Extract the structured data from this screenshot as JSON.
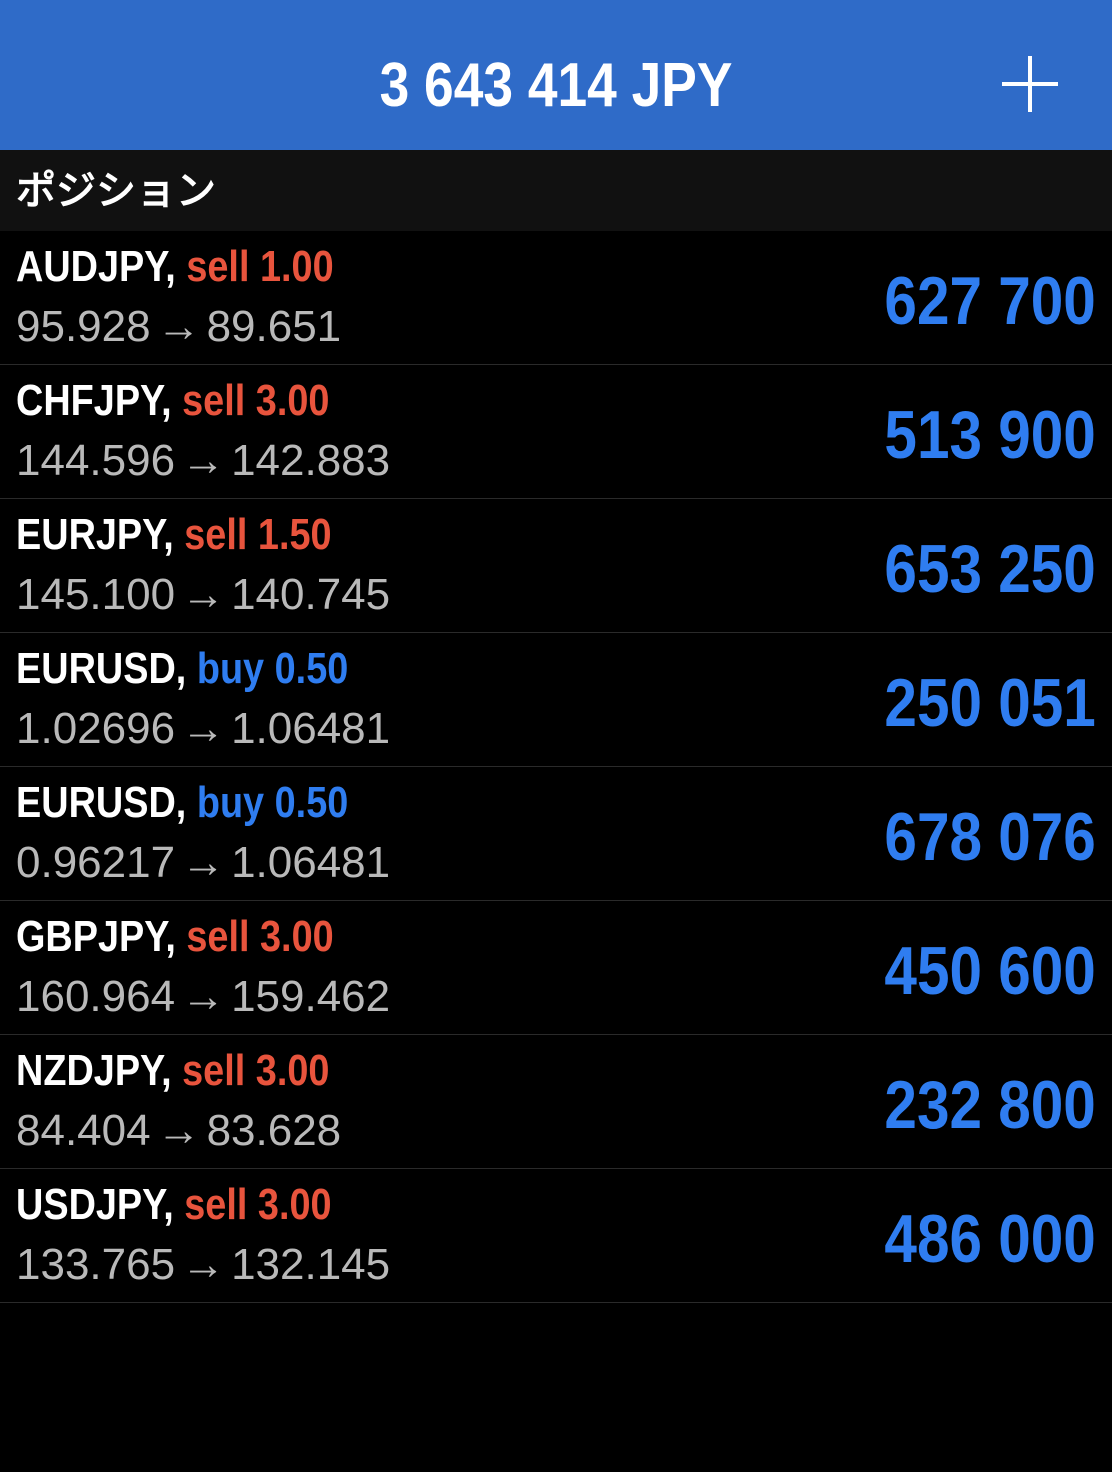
{
  "colors": {
    "header_bg": "#2f6bc8",
    "sell": "#e8543d",
    "buy": "#2f7df0",
    "profit": "#2f7df0"
  },
  "header": {
    "balance": "3 643 414 JPY",
    "add_icon": "plus-icon"
  },
  "section": {
    "title": "ポジション"
  },
  "positions": [
    {
      "symbol": "AUDJPY,",
      "side": "sell",
      "lots": "1.00",
      "open": "95.928",
      "arrow": "→",
      "current": "89.651",
      "profit": "627 700"
    },
    {
      "symbol": "CHFJPY,",
      "side": "sell",
      "lots": "3.00",
      "open": "144.596",
      "arrow": "→",
      "current": "142.883",
      "profit": "513 900"
    },
    {
      "symbol": "EURJPY,",
      "side": "sell",
      "lots": "1.50",
      "open": "145.100",
      "arrow": "→",
      "current": "140.745",
      "profit": "653 250"
    },
    {
      "symbol": "EURUSD,",
      "side": "buy",
      "lots": "0.50",
      "open": "1.02696",
      "arrow": "→",
      "current": "1.06481",
      "profit": "250 051"
    },
    {
      "symbol": "EURUSD,",
      "side": "buy",
      "lots": "0.50",
      "open": "0.96217",
      "arrow": "→",
      "current": "1.06481",
      "profit": "678 076"
    },
    {
      "symbol": "GBPJPY,",
      "side": "sell",
      "lots": "3.00",
      "open": "160.964",
      "arrow": "→",
      "current": "159.462",
      "profit": "450 600"
    },
    {
      "symbol": "NZDJPY,",
      "side": "sell",
      "lots": "3.00",
      "open": "84.404",
      "arrow": "→",
      "current": "83.628",
      "profit": "232 800"
    },
    {
      "symbol": "USDJPY,",
      "side": "sell",
      "lots": "3.00",
      "open": "133.765",
      "arrow": "→",
      "current": "132.145",
      "profit": "486 000"
    }
  ]
}
